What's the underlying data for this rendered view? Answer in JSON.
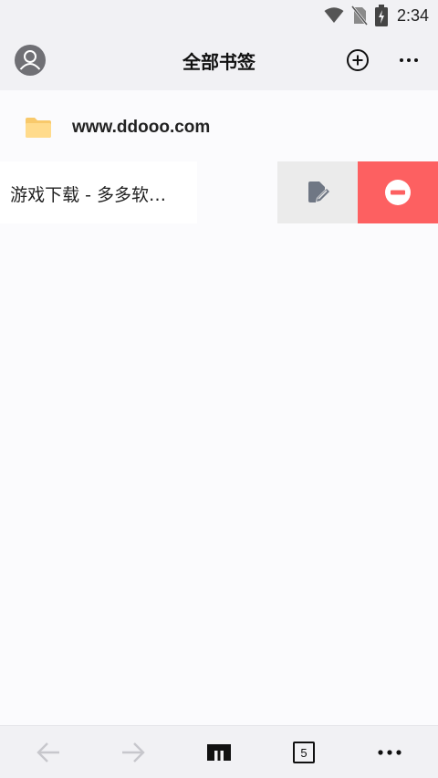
{
  "status_bar": {
    "time": "2:34",
    "icons": [
      "wifi-icon",
      "no-sim-icon",
      "battery-charging-icon"
    ]
  },
  "header": {
    "title": "全部书签",
    "left_icon": "avatar-icon",
    "right_icons": [
      "add-circle-icon",
      "more-horizontal-icon"
    ]
  },
  "bookmarks": {
    "folder": {
      "label": "www.ddooo.com",
      "icon": "folder-icon"
    },
    "item": {
      "title": "游戏下载 - 多多软…",
      "actions": [
        {
          "name": "edit",
          "icon": "edit-icon",
          "color": "#ebebeb"
        },
        {
          "name": "delete",
          "icon": "delete-icon",
          "color": "#fd6061"
        }
      ]
    }
  },
  "toolbar": {
    "items": [
      "back-arrow-icon",
      "forward-arrow-icon",
      "home-icon",
      "tabs-icon",
      "menu-icon"
    ],
    "tab_count": "5"
  },
  "colors": {
    "background": "#fbfbfd",
    "bars": "#f1f1f4",
    "folder": "#ffd98a",
    "delete": "#fd6061"
  }
}
